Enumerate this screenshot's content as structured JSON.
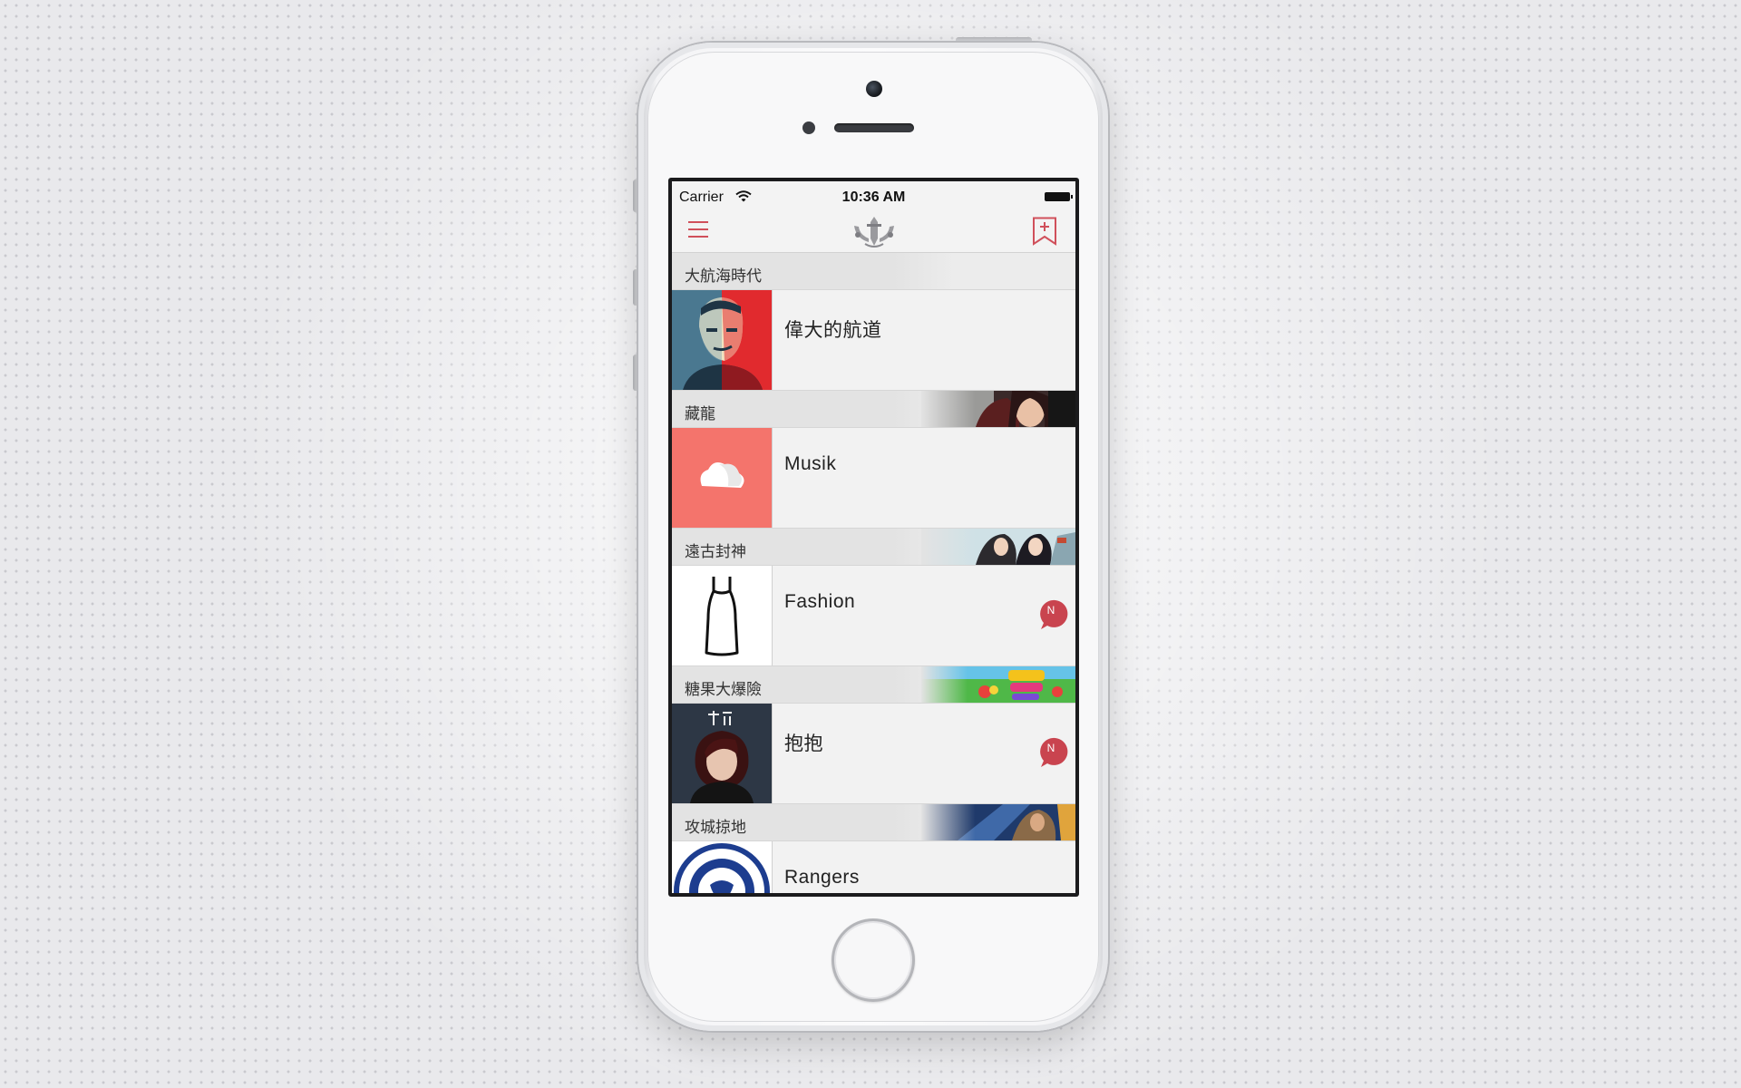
{
  "status_bar": {
    "carrier": "Carrier",
    "time": "10:36 AM"
  },
  "nav": {
    "menu_icon": "hamburger-icon",
    "logo_icon": "crest-logo-icon",
    "bookmark_icon": "bookmark-add-icon",
    "accent_color": "#d0505b"
  },
  "sections": [
    {
      "title": "大航海時代",
      "item": {
        "title": "偉大的航道",
        "badge": ""
      }
    },
    {
      "title": "藏龍",
      "item": {
        "title": "Musik",
        "badge": ""
      }
    },
    {
      "title": "遠古封神",
      "item": {
        "title": "Fashion",
        "badge": "N"
      }
    },
    {
      "title": "糖果大爆險",
      "item": {
        "title": "抱抱",
        "badge": "N"
      }
    },
    {
      "title": "攻城掠地",
      "item": {
        "title": "Rangers",
        "badge": ""
      }
    }
  ],
  "colors": {
    "badge": "#c9444f",
    "music_tile": "#f4746c"
  }
}
